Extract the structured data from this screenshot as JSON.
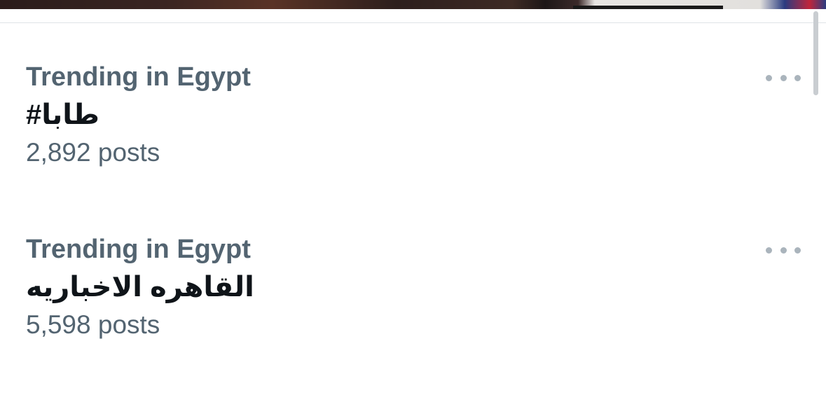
{
  "trends": [
    {
      "context": "Trending in Egypt",
      "name": "طابا#",
      "posts": "2,892 posts",
      "more_icon": "more-horizontal-icon"
    },
    {
      "context": "Trending in Egypt",
      "name": "القاهره الاخباريه",
      "posts": "5,598 posts",
      "more_icon": "more-horizontal-icon"
    }
  ],
  "colors": {
    "secondary_text": "#536471",
    "primary_text": "#0f1419",
    "icon": "#aab4bc",
    "divider": "#dfe3e6",
    "background": "#ffffff"
  }
}
